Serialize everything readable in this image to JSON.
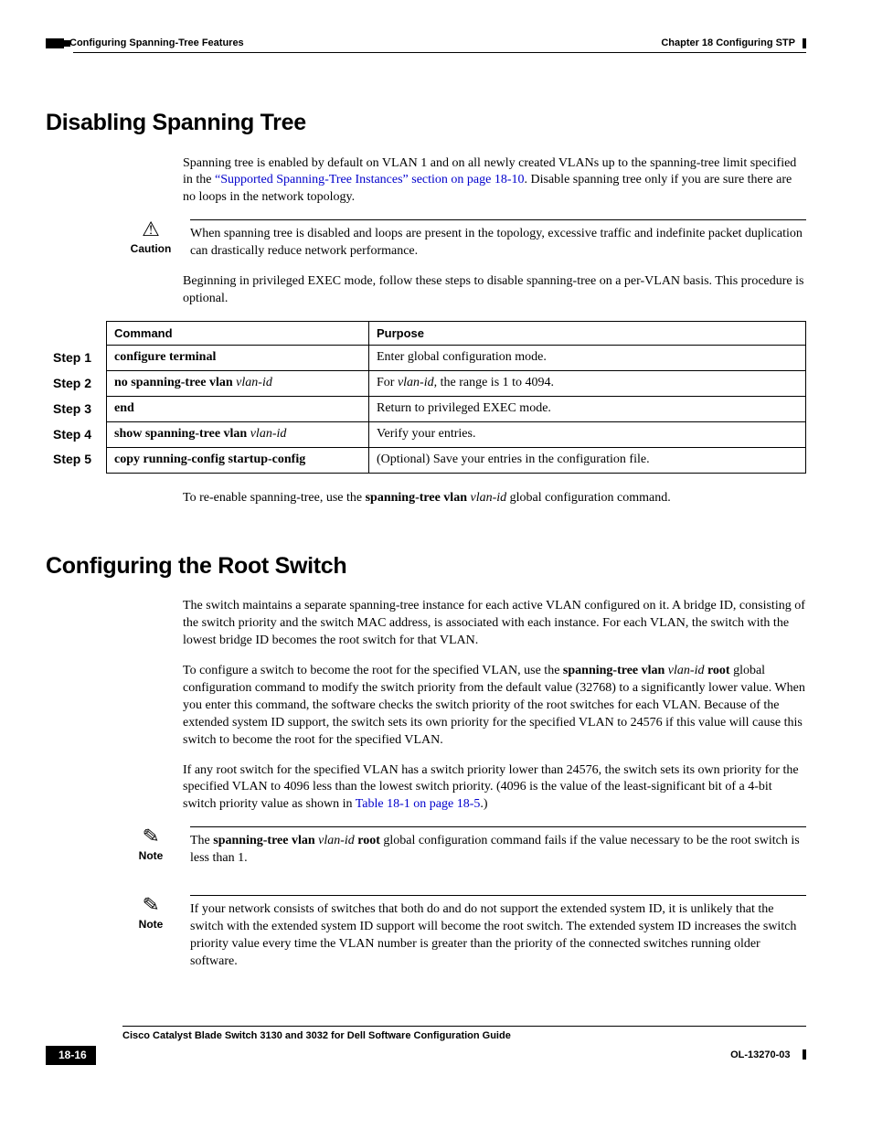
{
  "header": {
    "section_left": "Configuring Spanning-Tree Features",
    "chapter_right": "Chapter 18      Configuring STP"
  },
  "section1": {
    "heading": "Disabling Spanning Tree",
    "p1_a": "Spanning tree is enabled by default on VLAN 1 and on all newly created VLANs up to the spanning-tree limit specified in the ",
    "p1_link": "“Supported Spanning-Tree Instances” section on page 18-10",
    "p1_b": ". Disable spanning tree only if you are sure there are no loops in the network topology.",
    "caution_label": "Caution",
    "caution_text": "When spanning tree is disabled and loops are present in the topology, excessive traffic and indefinite packet duplication can drastically reduce network performance.",
    "p2": "Beginning in privileged EXEC mode, follow these steps to disable spanning-tree on a per-VLAN basis. This procedure is optional.",
    "table": {
      "h_step": "",
      "h_command": "Command",
      "h_purpose": "Purpose",
      "rows": [
        {
          "step": "Step 1",
          "cmd_b": "configure terminal",
          "cmd_i": "",
          "purpose": "Enter global configuration mode."
        },
        {
          "step": "Step 2",
          "cmd_b": "no spanning-tree vlan ",
          "cmd_i": "vlan-id",
          "purpose_a": "For ",
          "purpose_i": "vlan-id",
          "purpose_b": ", the range is 1 to 4094."
        },
        {
          "step": "Step 3",
          "cmd_b": "end",
          "cmd_i": "",
          "purpose": "Return to privileged EXEC mode."
        },
        {
          "step": "Step 4",
          "cmd_b": "show spanning-tree vlan ",
          "cmd_i": "vlan-id",
          "purpose": "Verify your entries."
        },
        {
          "step": "Step 5",
          "cmd_b": "copy running-config startup-config",
          "cmd_i": "",
          "purpose": "(Optional) Save your entries in the configuration file."
        }
      ]
    },
    "p3_a": "To re-enable spanning-tree, use the ",
    "p3_b": "spanning-tree vlan",
    "p3_i": " vlan-id ",
    "p3_c": "global configuration command."
  },
  "section2": {
    "heading": "Configuring the Root Switch",
    "p1": "The switch maintains a separate spanning-tree instance for each active VLAN configured on it. A bridge ID, consisting of the switch priority and the switch MAC address, is associated with each instance. For each VLAN, the switch with the lowest bridge ID becomes the root switch for that VLAN.",
    "p2_a": "To configure a switch to become the root for the specified VLAN, use the ",
    "p2_b1": "spanning-tree vlan",
    "p2_i": " vlan-id ",
    "p2_b2": "root",
    "p2_c": " global configuration command to modify the switch priority from the default value (32768) to a significantly lower value. When you enter this command, the software checks the switch priority of the root switches for each VLAN. Because of the extended system ID support, the switch sets its own priority for the specified VLAN to 24576 if this value will cause this switch to become the root for the specified VLAN.",
    "p3_a": "If any root switch for the specified VLAN has a switch priority lower than 24576, the switch sets its own priority for the specified VLAN to 4096 less than the lowest switch priority. (4096 is the value of the least-significant bit of a 4-bit switch priority value as shown in ",
    "p3_link": "Table 18-1 on page 18-5",
    "p3_b": ".)",
    "note1_label": "Note",
    "note1_a": "The ",
    "note1_b1": "spanning-tree vlan",
    "note1_i": " vlan-id ",
    "note1_b2": "root",
    "note1_c": " global configuration command fails if the value necessary to be the root switch is less than 1.",
    "note2_label": "Note",
    "note2_text": "If your network consists of switches that both do and do not support the extended system ID, it is unlikely that the switch with the extended system ID support will become the root switch. The extended system ID increases the switch priority value every time the VLAN number is greater than the priority of the connected switches running older software."
  },
  "footer": {
    "title": "Cisco Catalyst Blade Switch 3130 and 3032 for Dell Software Configuration Guide",
    "page": "18-16",
    "docid": "OL-13270-03"
  }
}
